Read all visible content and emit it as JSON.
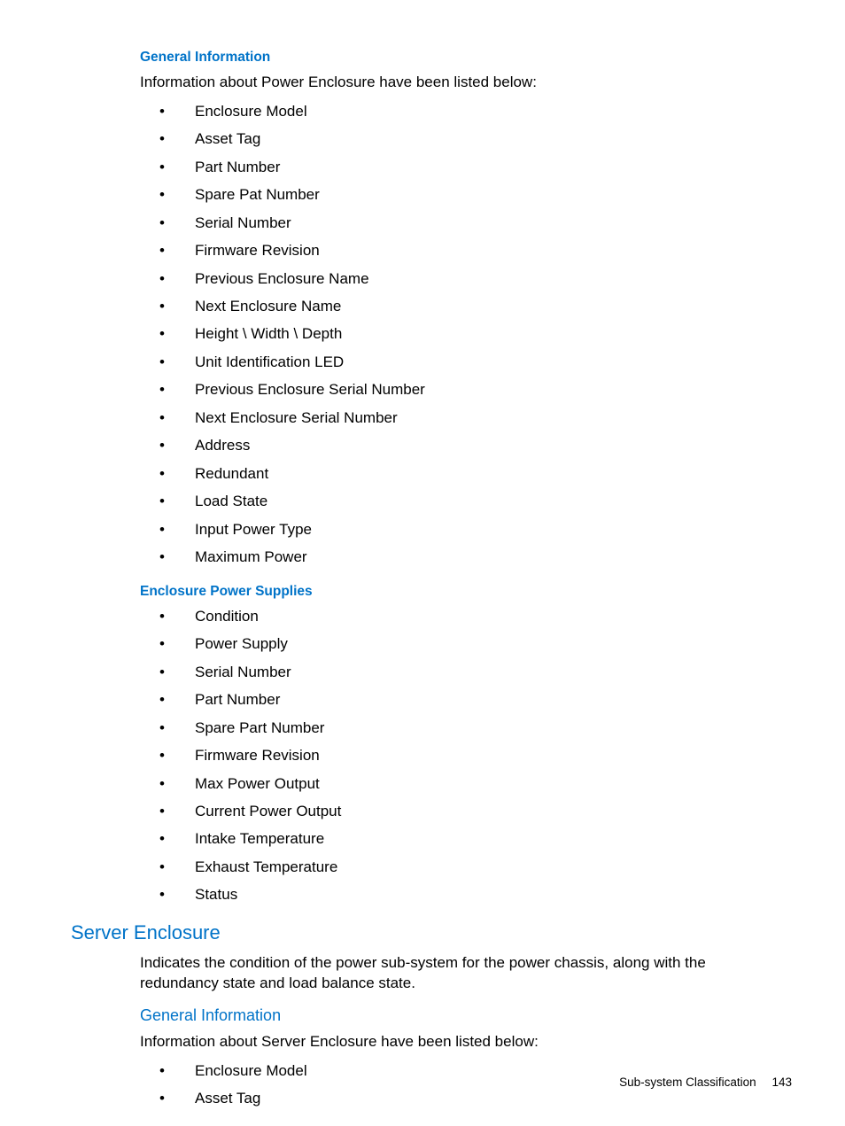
{
  "sections": {
    "general_info_1": {
      "heading": "General Information",
      "intro": "Information about Power Enclosure have been listed below:",
      "items": [
        "Enclosure Model",
        "Asset Tag",
        "Part Number",
        "Spare Pat Number",
        "Serial Number",
        "Firmware Revision",
        "Previous Enclosure Name",
        "Next Enclosure Name",
        "Height \\ Width \\ Depth",
        "Unit Identification LED",
        "Previous Enclosure Serial Number",
        "Next Enclosure Serial Number",
        "Address",
        "Redundant",
        "Load State",
        "Input Power Type",
        "Maximum Power"
      ]
    },
    "enclosure_power_supplies": {
      "heading": "Enclosure Power Supplies",
      "items": [
        "Condition",
        "Power Supply",
        "Serial Number",
        "Part Number",
        "Spare Part Number",
        "Firmware Revision",
        "Max Power Output",
        "Current Power Output",
        "Intake Temperature",
        "Exhaust Temperature",
        "Status"
      ]
    },
    "server_enclosure": {
      "heading": "Server Enclosure",
      "description": "Indicates the condition of the power sub-system for the power chassis, along with the redundancy state and load balance state.",
      "general_info_heading": "General Information",
      "general_info_intro": "Information about Server Enclosure have been listed below:",
      "items": [
        "Enclosure Model",
        "Asset Tag"
      ]
    }
  },
  "footer": {
    "label": "Sub-system Classification",
    "page": "143"
  }
}
